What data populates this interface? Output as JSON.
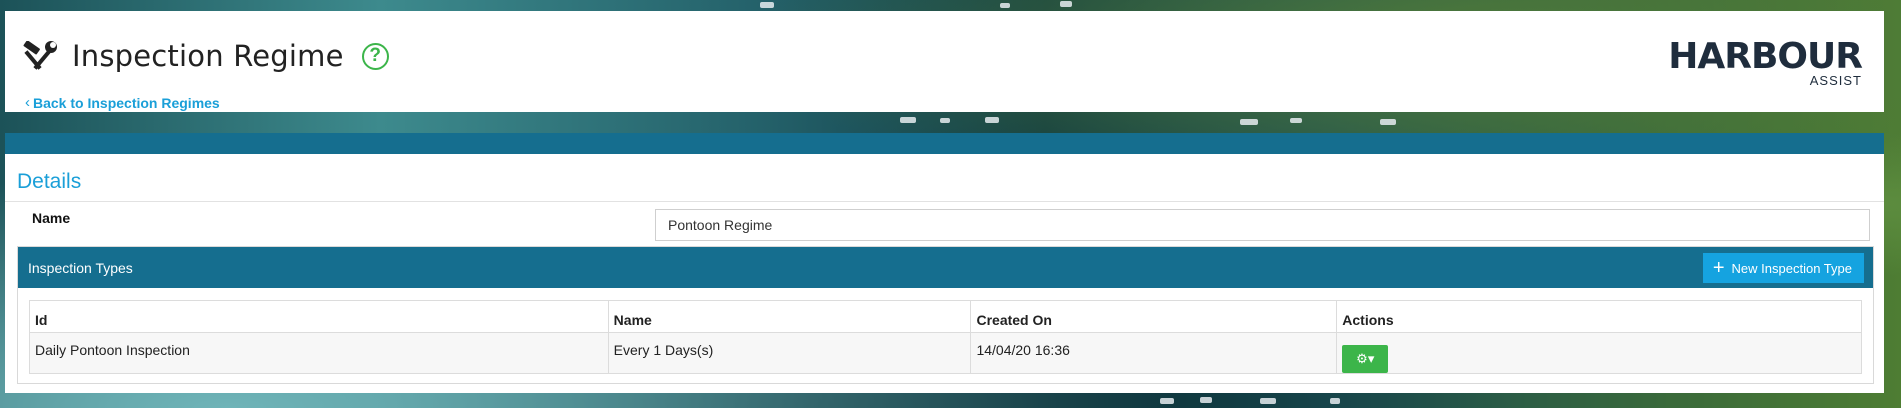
{
  "header": {
    "title": "Inspection Regime",
    "back_link": "Back to Inspection Regimes",
    "help_icon": "question-circle-icon",
    "title_icon": "hammer-wrench-icon"
  },
  "logo": {
    "main": "HARBOUR",
    "sub": "ASSIST"
  },
  "details": {
    "section_title": "Details",
    "name_label": "Name",
    "name_value": "Pontoon Regime"
  },
  "inspection_types": {
    "title": "Inspection Types",
    "new_button": "New Inspection Type",
    "columns": [
      "Id",
      "Name",
      "Created On",
      "Actions"
    ],
    "rows": [
      {
        "id": "Daily Pontoon Inspection",
        "name": "Every 1 Days(s)",
        "created_on": "14/04/20 16:36",
        "action_icon": "gear-dropdown-icon"
      }
    ]
  },
  "colors": {
    "accent_blue": "#1a9fd8",
    "bar_teal": "#156e8f",
    "button_blue": "#15a3e0",
    "green": "#3cb54a"
  }
}
